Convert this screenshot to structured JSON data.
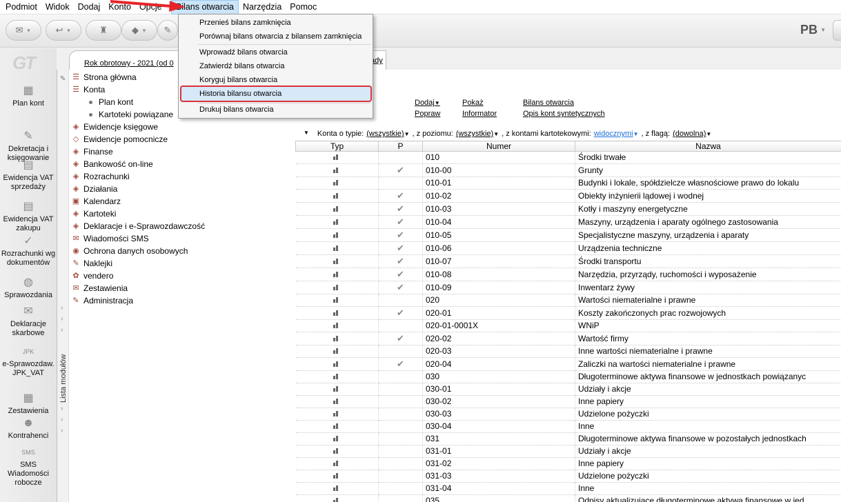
{
  "menubar": {
    "items": [
      "Podmiot",
      "Widok",
      "Dodaj",
      "Konto",
      "Opcje",
      "Bilans otwarcia",
      "Narzędzia",
      "Pomoc"
    ]
  },
  "toolbar": {
    "user_initials": "PB"
  },
  "logo": "GT",
  "leftnav": [
    {
      "label": "Plan kont",
      "icon": "chart-of-accounts-icon"
    },
    {
      "label": "Dekretacja i księgowanie",
      "icon": "posting-icon"
    },
    {
      "label": "Ewidencja VAT sprzedaży",
      "icon": "vat-sales-icon"
    },
    {
      "label": "Ewidencja VAT zakupu",
      "icon": "vat-purchase-icon"
    },
    {
      "label": "Rozrachunki wg dokumentów",
      "icon": "settlements-icon"
    },
    {
      "label": "Sprawozdania",
      "icon": "reports-icon"
    },
    {
      "label": "Deklaracje skarbowe",
      "icon": "tax-declarations-icon"
    },
    {
      "label": "e-Sprawozdaw. JPK_VAT",
      "icon": "jpk-icon",
      "badge": "JPK"
    },
    {
      "label": "Zestawienia",
      "icon": "summaries-icon"
    },
    {
      "label": "Kontrahenci",
      "icon": "contractors-icon"
    },
    {
      "label": "SMS Wiadomości robocze",
      "icon": "sms-icon",
      "badge": "SMS"
    }
  ],
  "module_panel": {
    "strip_label": "Lista modułów",
    "items": [
      {
        "label": "Strona główna",
        "level": 0
      },
      {
        "label": "Konta",
        "level": 0
      },
      {
        "label": "Plan kont",
        "level": 1
      },
      {
        "label": "Kartoteki powiązane",
        "level": 1
      },
      {
        "label": "Ewidencje księgowe",
        "level": 0
      },
      {
        "label": "Ewidencje pomocnicze",
        "level": 0
      },
      {
        "label": "Finanse",
        "level": 0
      },
      {
        "label": "Bankowość on-line",
        "level": 0
      },
      {
        "label": "Rozrachunki",
        "level": 0
      },
      {
        "label": "Działania",
        "level": 0
      },
      {
        "label": "Kalendarz",
        "level": 0
      },
      {
        "label": "Kartoteki",
        "level": 0
      },
      {
        "label": "Deklaracje i e-Sprawozdawczość",
        "level": 0
      },
      {
        "label": "Wiadomości SMS",
        "level": 0
      },
      {
        "label": "Ochrona danych osobowych",
        "level": 0
      },
      {
        "label": "Naklejki",
        "level": 0
      },
      {
        "label": "vendero",
        "level": 0
      },
      {
        "label": "Zestawienia",
        "level": 0
      },
      {
        "label": "Administracja",
        "level": 0
      }
    ]
  },
  "tab": {
    "text_left": "Rok obrotowy - 2021 (od 0",
    "text_right": "ady"
  },
  "actions": {
    "dodaj": "Dodaj",
    "popraw": "Popraw",
    "pokaz": "Pokaż",
    "informator": "Informator",
    "bilans_otwarcia": "Bilans otwarcia",
    "opis_kont": "Opis kont syntetycznych"
  },
  "filter": {
    "typ_label": "Konta o typie:",
    "typ_value": "(wszystkie)",
    "poziom_label": ", z poziomu:",
    "poziom_value": "(wszystkie)",
    "kartoteki_label": ", z kontami kartotekowymi:",
    "kartoteki_value": "widocznymi",
    "flaga_label": ", z flagą:",
    "flaga_value": "(dowolna)"
  },
  "grid": {
    "columns": [
      "Typ",
      "P",
      "Numer",
      "Nazwa"
    ],
    "rows": [
      {
        "p": false,
        "numer": "010",
        "nazwa": "Środki trwałe"
      },
      {
        "p": true,
        "numer": "010-00",
        "nazwa": "Grunty"
      },
      {
        "p": false,
        "numer": "010-01",
        "nazwa": "Budynki i lokale, spółdzielcze własnościowe prawo do lokalu"
      },
      {
        "p": true,
        "numer": "010-02",
        "nazwa": "Obiekty inżynierii lądowej i wodnej"
      },
      {
        "p": true,
        "numer": "010-03",
        "nazwa": "Kotły i maszyny energetyczne"
      },
      {
        "p": true,
        "numer": "010-04",
        "nazwa": "Maszyny, urządzenia i aparaty ogólnego zastosowania"
      },
      {
        "p": true,
        "numer": "010-05",
        "nazwa": "Specjalistyczne maszyny, urządzenia i aparaty"
      },
      {
        "p": true,
        "numer": "010-06",
        "nazwa": "Urządzenia techniczne"
      },
      {
        "p": true,
        "numer": "010-07",
        "nazwa": "Środki transportu"
      },
      {
        "p": true,
        "numer": "010-08",
        "nazwa": "Narzędzia, przyrządy, ruchomości i wyposażenie"
      },
      {
        "p": true,
        "numer": "010-09",
        "nazwa": "Inwentarz żywy"
      },
      {
        "p": false,
        "numer": "020",
        "nazwa": "Wartości niematerialne i prawne"
      },
      {
        "p": true,
        "numer": "020-01",
        "nazwa": "Koszty zakończonych prac rozwojowych"
      },
      {
        "p": false,
        "numer": "020-01-0001X",
        "nazwa": "WNiP"
      },
      {
        "p": true,
        "numer": "020-02",
        "nazwa": "Wartość firmy"
      },
      {
        "p": false,
        "numer": "020-03",
        "nazwa": "Inne wartości niematerialne i prawne"
      },
      {
        "p": true,
        "numer": "020-04",
        "nazwa": "Zaliczki na wartości niematerialne i prawne"
      },
      {
        "p": false,
        "numer": "030",
        "nazwa": "Długoterminowe aktywa finansowe w jednostkach powiązanyc"
      },
      {
        "p": false,
        "numer": "030-01",
        "nazwa": "Udziały i akcje"
      },
      {
        "p": false,
        "numer": "030-02",
        "nazwa": "Inne papiery"
      },
      {
        "p": false,
        "numer": "030-03",
        "nazwa": "Udzielone pożyczki"
      },
      {
        "p": false,
        "numer": "030-04",
        "nazwa": "Inne"
      },
      {
        "p": false,
        "numer": "031",
        "nazwa": "Długoterminowe aktywa finansowe w pozostałych jednostkach"
      },
      {
        "p": false,
        "numer": "031-01",
        "nazwa": "Udziały i akcje"
      },
      {
        "p": false,
        "numer": "031-02",
        "nazwa": "Inne papiery"
      },
      {
        "p": false,
        "numer": "031-03",
        "nazwa": "Udzielone pożyczki"
      },
      {
        "p": false,
        "numer": "031-04",
        "nazwa": "Inne"
      },
      {
        "p": false,
        "numer": "035",
        "nazwa": "Odpisy aktualizujące długoterminowe aktywa finansowe w jed"
      }
    ]
  },
  "dropdown": {
    "items": [
      "Przenieś bilans zamknięcia",
      "Porównaj bilans otwarcia z bilansem zamknięcia",
      "Wprowadź bilans otwarcia",
      "Zatwierdź bilans otwarcia",
      "Koryguj bilans otwarcia",
      "Historia bilansu otwarcia",
      "Drukuj bilans otwarcia"
    ],
    "highlighted_index": 5
  },
  "colors": {
    "highlight_border": "#d9323b",
    "menu_active": "#cce4f7",
    "arrow": "#e8242a",
    "link_blue": "#1c6fd6"
  }
}
